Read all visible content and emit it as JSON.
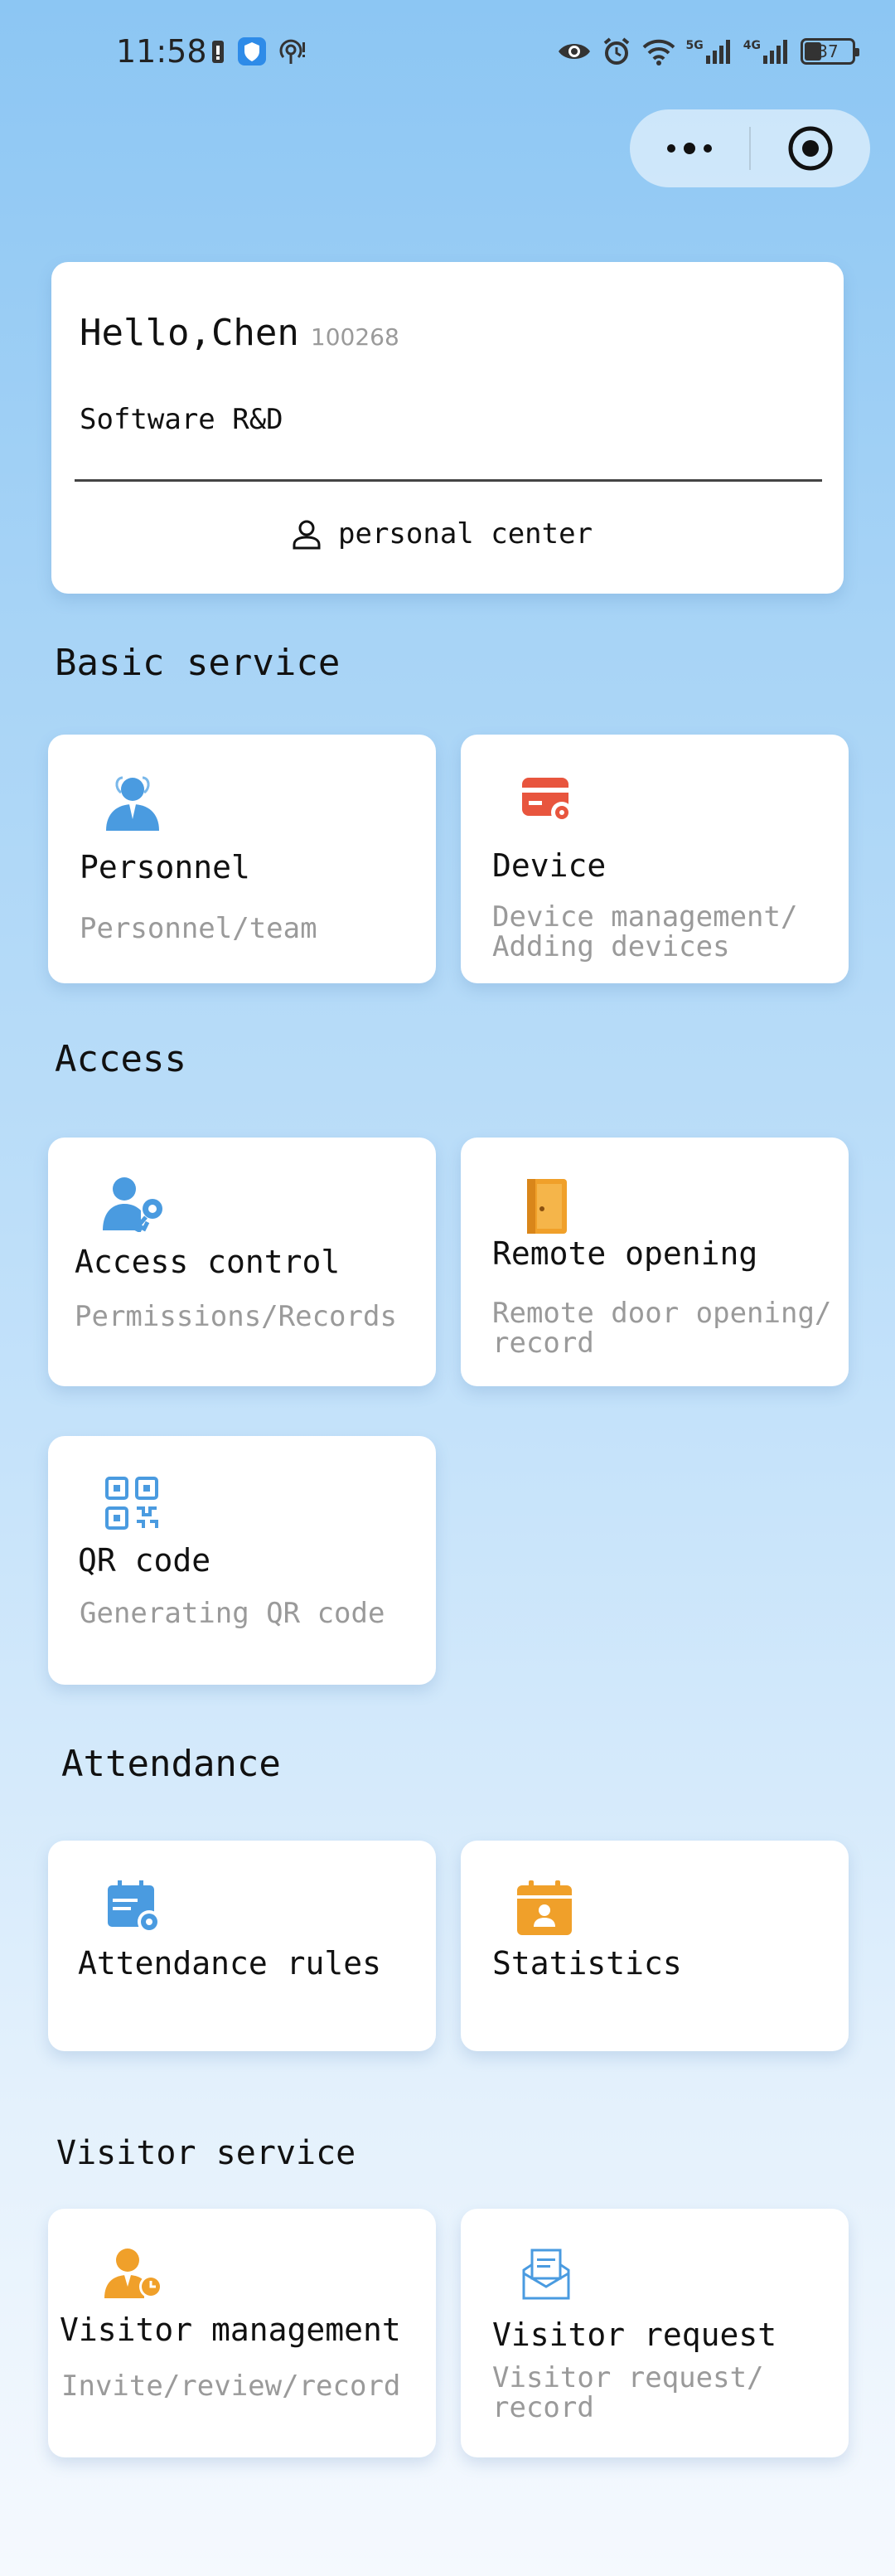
{
  "status_bar": {
    "time": "11:58",
    "battery": "37",
    "net1": "5G",
    "net2": "4G"
  },
  "user": {
    "greeting": "Hello,Chen",
    "id": "100268",
    "department": "Software R&D",
    "personal_center": "personal center"
  },
  "sections": {
    "basic": "Basic service",
    "access": "Access",
    "attendance": "Attendance",
    "visitor": "Visitor service"
  },
  "tiles": {
    "personnel": {
      "title": "Personnel",
      "sub1": "Personnel/team"
    },
    "device": {
      "title": "Device",
      "sub1": "Device management/",
      "sub2": "Adding devices"
    },
    "access_control": {
      "title": "Access control",
      "sub1": "Permissions/Records"
    },
    "remote_opening": {
      "title": "Remote opening",
      "sub1": "Remote door opening/",
      "sub2": "record"
    },
    "qr_code": {
      "title": "QR code",
      "sub1": "Generating QR code"
    },
    "attendance_rules": {
      "title": "Attendance rules"
    },
    "statistics": {
      "title": "Statistics"
    },
    "visitor_management": {
      "title": "Visitor management",
      "sub1": "Invite/review/record"
    },
    "visitor_request": {
      "title": "Visitor request",
      "sub1": "Visitor request/",
      "sub2": "record"
    }
  },
  "colors": {
    "blue_icon": "#4a9be0",
    "orange_icon": "#f0a02a",
    "red_icon": "#e8553e"
  }
}
